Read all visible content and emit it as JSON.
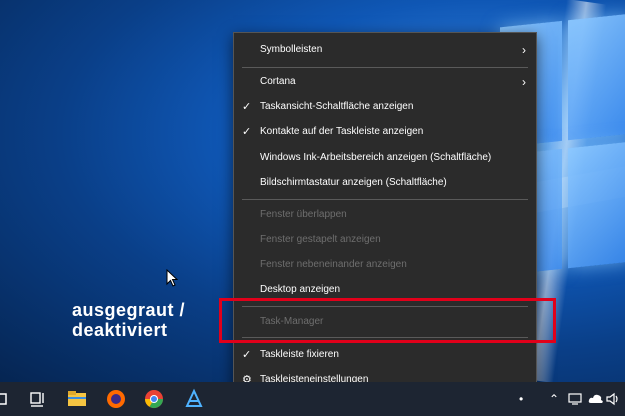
{
  "menu": {
    "items": [
      {
        "label": "Symbolleisten",
        "submenu": true
      },
      {
        "label": "Cortana",
        "submenu": true
      },
      {
        "label": "Taskansicht-Schaltfläche anzeigen",
        "checked": true
      },
      {
        "label": "Kontakte auf der Taskleiste anzeigen",
        "checked": true
      },
      {
        "label": "Windows Ink-Arbeitsbereich anzeigen (Schaltfläche)"
      },
      {
        "label": "Bildschirmtastatur anzeigen (Schaltfläche)"
      },
      {
        "label": "Fenster überlappen",
        "disabled": true
      },
      {
        "label": "Fenster gestapelt anzeigen",
        "disabled": true
      },
      {
        "label": "Fenster nebeneinander anzeigen",
        "disabled": true
      },
      {
        "label": "Desktop anzeigen"
      },
      {
        "label": "Task-Manager",
        "disabled": true
      },
      {
        "label": "Taskleiste fixieren",
        "checked": true
      },
      {
        "label": "Taskleisteneinstellungen",
        "icon": "gear-icon"
      }
    ]
  },
  "annotation": {
    "line1": "ausgegraut /",
    "line2": "deaktiviert"
  },
  "colors": {
    "highlight": "#e1001a",
    "menu_bg": "#2b2b2b",
    "taskbar_bg": "#1d2532",
    "disabled_text": "#6e6e6e"
  },
  "taskbar": {
    "pinned": [
      "task-view-icon",
      "file-explorer-icon",
      "firefox-icon",
      "chrome-icon",
      "app-icon"
    ],
    "tray": [
      "chevron-up-icon",
      "network-icon",
      "cloud-icon",
      "volume-icon"
    ]
  }
}
